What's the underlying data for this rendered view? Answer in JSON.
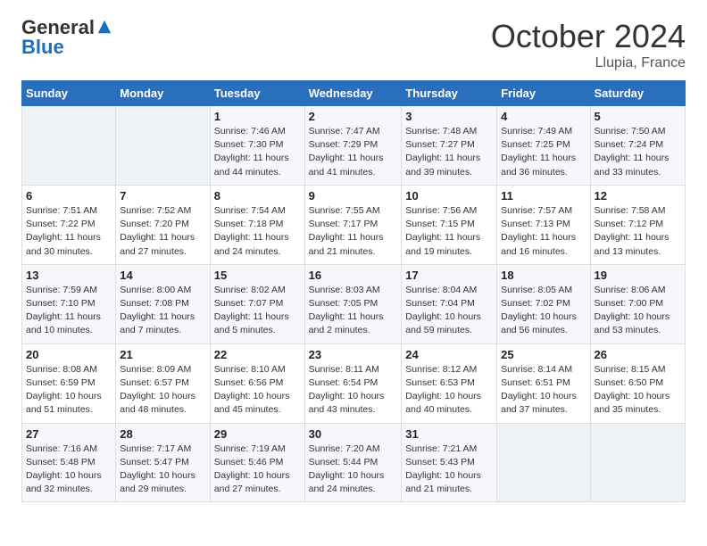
{
  "header": {
    "logo_general": "General",
    "logo_blue": "Blue",
    "title": "October 2024",
    "location": "Llupia, France"
  },
  "days_of_week": [
    "Sunday",
    "Monday",
    "Tuesday",
    "Wednesday",
    "Thursday",
    "Friday",
    "Saturday"
  ],
  "weeks": [
    [
      {
        "day": "",
        "info": ""
      },
      {
        "day": "",
        "info": ""
      },
      {
        "day": "1",
        "info": "Sunrise: 7:46 AM\nSunset: 7:30 PM\nDaylight: 11 hours and 44 minutes."
      },
      {
        "day": "2",
        "info": "Sunrise: 7:47 AM\nSunset: 7:29 PM\nDaylight: 11 hours and 41 minutes."
      },
      {
        "day": "3",
        "info": "Sunrise: 7:48 AM\nSunset: 7:27 PM\nDaylight: 11 hours and 39 minutes."
      },
      {
        "day": "4",
        "info": "Sunrise: 7:49 AM\nSunset: 7:25 PM\nDaylight: 11 hours and 36 minutes."
      },
      {
        "day": "5",
        "info": "Sunrise: 7:50 AM\nSunset: 7:24 PM\nDaylight: 11 hours and 33 minutes."
      }
    ],
    [
      {
        "day": "6",
        "info": "Sunrise: 7:51 AM\nSunset: 7:22 PM\nDaylight: 11 hours and 30 minutes."
      },
      {
        "day": "7",
        "info": "Sunrise: 7:52 AM\nSunset: 7:20 PM\nDaylight: 11 hours and 27 minutes."
      },
      {
        "day": "8",
        "info": "Sunrise: 7:54 AM\nSunset: 7:18 PM\nDaylight: 11 hours and 24 minutes."
      },
      {
        "day": "9",
        "info": "Sunrise: 7:55 AM\nSunset: 7:17 PM\nDaylight: 11 hours and 21 minutes."
      },
      {
        "day": "10",
        "info": "Sunrise: 7:56 AM\nSunset: 7:15 PM\nDaylight: 11 hours and 19 minutes."
      },
      {
        "day": "11",
        "info": "Sunrise: 7:57 AM\nSunset: 7:13 PM\nDaylight: 11 hours and 16 minutes."
      },
      {
        "day": "12",
        "info": "Sunrise: 7:58 AM\nSunset: 7:12 PM\nDaylight: 11 hours and 13 minutes."
      }
    ],
    [
      {
        "day": "13",
        "info": "Sunrise: 7:59 AM\nSunset: 7:10 PM\nDaylight: 11 hours and 10 minutes."
      },
      {
        "day": "14",
        "info": "Sunrise: 8:00 AM\nSunset: 7:08 PM\nDaylight: 11 hours and 7 minutes."
      },
      {
        "day": "15",
        "info": "Sunrise: 8:02 AM\nSunset: 7:07 PM\nDaylight: 11 hours and 5 minutes."
      },
      {
        "day": "16",
        "info": "Sunrise: 8:03 AM\nSunset: 7:05 PM\nDaylight: 11 hours and 2 minutes."
      },
      {
        "day": "17",
        "info": "Sunrise: 8:04 AM\nSunset: 7:04 PM\nDaylight: 10 hours and 59 minutes."
      },
      {
        "day": "18",
        "info": "Sunrise: 8:05 AM\nSunset: 7:02 PM\nDaylight: 10 hours and 56 minutes."
      },
      {
        "day": "19",
        "info": "Sunrise: 8:06 AM\nSunset: 7:00 PM\nDaylight: 10 hours and 53 minutes."
      }
    ],
    [
      {
        "day": "20",
        "info": "Sunrise: 8:08 AM\nSunset: 6:59 PM\nDaylight: 10 hours and 51 minutes."
      },
      {
        "day": "21",
        "info": "Sunrise: 8:09 AM\nSunset: 6:57 PM\nDaylight: 10 hours and 48 minutes."
      },
      {
        "day": "22",
        "info": "Sunrise: 8:10 AM\nSunset: 6:56 PM\nDaylight: 10 hours and 45 minutes."
      },
      {
        "day": "23",
        "info": "Sunrise: 8:11 AM\nSunset: 6:54 PM\nDaylight: 10 hours and 43 minutes."
      },
      {
        "day": "24",
        "info": "Sunrise: 8:12 AM\nSunset: 6:53 PM\nDaylight: 10 hours and 40 minutes."
      },
      {
        "day": "25",
        "info": "Sunrise: 8:14 AM\nSunset: 6:51 PM\nDaylight: 10 hours and 37 minutes."
      },
      {
        "day": "26",
        "info": "Sunrise: 8:15 AM\nSunset: 6:50 PM\nDaylight: 10 hours and 35 minutes."
      }
    ],
    [
      {
        "day": "27",
        "info": "Sunrise: 7:16 AM\nSunset: 5:48 PM\nDaylight: 10 hours and 32 minutes."
      },
      {
        "day": "28",
        "info": "Sunrise: 7:17 AM\nSunset: 5:47 PM\nDaylight: 10 hours and 29 minutes."
      },
      {
        "day": "29",
        "info": "Sunrise: 7:19 AM\nSunset: 5:46 PM\nDaylight: 10 hours and 27 minutes."
      },
      {
        "day": "30",
        "info": "Sunrise: 7:20 AM\nSunset: 5:44 PM\nDaylight: 10 hours and 24 minutes."
      },
      {
        "day": "31",
        "info": "Sunrise: 7:21 AM\nSunset: 5:43 PM\nDaylight: 10 hours and 21 minutes."
      },
      {
        "day": "",
        "info": ""
      },
      {
        "day": "",
        "info": ""
      }
    ]
  ]
}
